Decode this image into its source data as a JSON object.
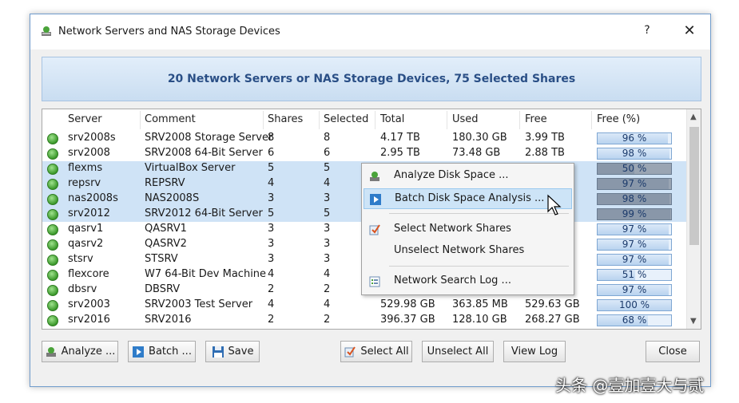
{
  "window": {
    "title": "Network Servers and NAS Storage Devices",
    "help": "?",
    "close": "✕"
  },
  "banner": {
    "text": "20 Network Servers or NAS Storage Devices, 75 Selected Shares"
  },
  "table": {
    "columns": [
      "Server",
      "Comment",
      "Shares",
      "Selected",
      "Total",
      "Used",
      "Free",
      "Free (%)"
    ],
    "rows": [
      {
        "server": "srv2008s",
        "comment": "SRV2008 Storage Server",
        "shares": "8",
        "selected": "8",
        "total": "4.17 TB",
        "used": "180.30 GB",
        "free": "3.99 TB",
        "free_pct": "96 %",
        "pct": 0.96,
        "sel": false
      },
      {
        "server": "srv2008",
        "comment": "SRV2008 64-Bit Server",
        "shares": "6",
        "selected": "6",
        "total": "2.95 TB",
        "used": "73.48 GB",
        "free": "2.88 TB",
        "free_pct": "98 %",
        "pct": 0.98,
        "sel": false
      },
      {
        "server": "flexms",
        "comment": "VirtualBox Server",
        "shares": "5",
        "selected": "5",
        "total": "",
        "used": "",
        "free": "",
        "free_pct": "50 %",
        "pct": 0.5,
        "sel": true
      },
      {
        "server": "repsrv",
        "comment": "REPSRV",
        "shares": "4",
        "selected": "4",
        "total": "",
        "used": "",
        "free": "",
        "free_pct": "97 %",
        "pct": 0.97,
        "sel": true
      },
      {
        "server": "nas2008s",
        "comment": "NAS2008S",
        "shares": "3",
        "selected": "3",
        "total": "",
        "used": "",
        "free": "",
        "free_pct": "98 %",
        "pct": 0.98,
        "sel": true
      },
      {
        "server": "srv2012",
        "comment": "SRV2012 64-Bit Server",
        "shares": "5",
        "selected": "5",
        "total": "",
        "used": "",
        "free": "",
        "free_pct": "99 %",
        "pct": 0.99,
        "sel": true
      },
      {
        "server": "qasrv1",
        "comment": "QASRV1",
        "shares": "3",
        "selected": "3",
        "total": "",
        "used": "",
        "free": "",
        "free_pct": "97 %",
        "pct": 0.97,
        "sel": false
      },
      {
        "server": "qasrv2",
        "comment": "QASRV2",
        "shares": "3",
        "selected": "3",
        "total": "",
        "used": "",
        "free": "",
        "free_pct": "97 %",
        "pct": 0.97,
        "sel": false
      },
      {
        "server": "stsrv",
        "comment": "STSRV",
        "shares": "3",
        "selected": "3",
        "total": "",
        "used": "",
        "free": "",
        "free_pct": "97 %",
        "pct": 0.97,
        "sel": false
      },
      {
        "server": "flexcore",
        "comment": "W7 64-Bit Dev Machine",
        "shares": "4",
        "selected": "4",
        "total": "",
        "used": "",
        "free": "",
        "free_pct": "51 %",
        "pct": 0.51,
        "sel": false
      },
      {
        "server": "dbsrv",
        "comment": "DBSRV",
        "shares": "2",
        "selected": "2",
        "total": "",
        "used": "",
        "free": "",
        "free_pct": "97 %",
        "pct": 0.97,
        "sel": false
      },
      {
        "server": "srv2003",
        "comment": "SRV2003 Test Server",
        "shares": "4",
        "selected": "4",
        "total": "529.98 GB",
        "used": "363.85 MB",
        "free": "529.63 GB",
        "free_pct": "100 %",
        "pct": 1.0,
        "sel": false
      },
      {
        "server": "srv2016",
        "comment": "SRV2016",
        "shares": "2",
        "selected": "2",
        "total": "396.37 GB",
        "used": "128.10 GB",
        "free": "268.27 GB",
        "free_pct": "68 %",
        "pct": 0.68,
        "sel": false
      }
    ]
  },
  "context_menu": {
    "items": [
      {
        "label": "Analyze Disk Space ...",
        "icon": "disk-analyze-icon"
      },
      {
        "label": "Batch Disk Space Analysis ...",
        "icon": "play-icon"
      },
      {
        "label": "Select Network Shares",
        "icon": "select-icon"
      },
      {
        "label": "Unselect Network Shares",
        "icon": ""
      },
      {
        "label": "Network Search Log ...",
        "icon": "log-icon"
      }
    ]
  },
  "buttons": {
    "analyze": "Analyze ...",
    "batch": "Batch ...",
    "save": "Save",
    "select_all": "Select All",
    "unselect_all": "Unselect All",
    "view_log": "View Log",
    "close": "Close"
  },
  "watermark": "头条 @壹加壹大与贰",
  "colors": {
    "banner_text": "#2a4f86",
    "selection": "#cfe3f6",
    "menu_highlight": "#cde4f7",
    "status_green": "#3c9a2c"
  }
}
